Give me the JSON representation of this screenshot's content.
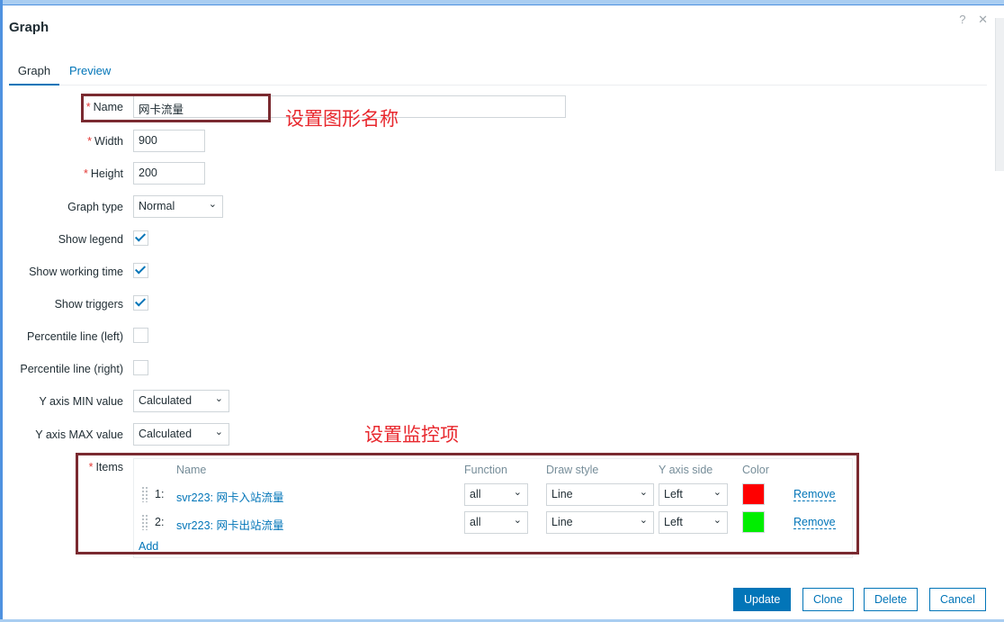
{
  "dialog": {
    "title": "Graph",
    "help_icon": "?",
    "close_icon": "✕"
  },
  "tabs": [
    {
      "label": "Graph",
      "active": true
    },
    {
      "label": "Preview",
      "active": false
    }
  ],
  "form": {
    "name": {
      "label": "Name",
      "value": "网卡流量"
    },
    "width": {
      "label": "Width",
      "value": "900"
    },
    "height": {
      "label": "Height",
      "value": "200"
    },
    "graph_type": {
      "label": "Graph type",
      "value": "Normal"
    },
    "show_legend": {
      "label": "Show legend",
      "checked": true
    },
    "show_working_time": {
      "label": "Show working time",
      "checked": true
    },
    "show_triggers": {
      "label": "Show triggers",
      "checked": true
    },
    "percentile_left": {
      "label": "Percentile line (left)",
      "checked": false
    },
    "percentile_right": {
      "label": "Percentile line (right)",
      "checked": false
    },
    "y_min": {
      "label": "Y axis MIN value",
      "value": "Calculated"
    },
    "y_max": {
      "label": "Y axis MAX value",
      "value": "Calculated"
    },
    "items_label": "Items"
  },
  "items": {
    "headers": {
      "name": "Name",
      "function": "Function",
      "draw_style": "Draw style",
      "y_axis_side": "Y axis side",
      "color": "Color"
    },
    "rows": [
      {
        "num": "1:",
        "name": "svr223: 网卡入站流量",
        "function": "all",
        "draw_style": "Line",
        "y_axis_side": "Left",
        "color": "#ff0000",
        "remove": "Remove"
      },
      {
        "num": "2:",
        "name": "svr223: 网卡出站流量",
        "function": "all",
        "draw_style": "Line",
        "y_axis_side": "Left",
        "color": "#00ee00",
        "remove": "Remove"
      }
    ],
    "add_label": "Add"
  },
  "annotations": {
    "name_note": "设置图形名称",
    "items_note": "设置监控项"
  },
  "buttons": {
    "update": "Update",
    "clone": "Clone",
    "delete": "Delete",
    "cancel": "Cancel"
  },
  "colors": {
    "accent": "#0275b8",
    "required": "#e33734",
    "annotation_text": "#e8282e",
    "annotation_box": "#7a2a30"
  }
}
